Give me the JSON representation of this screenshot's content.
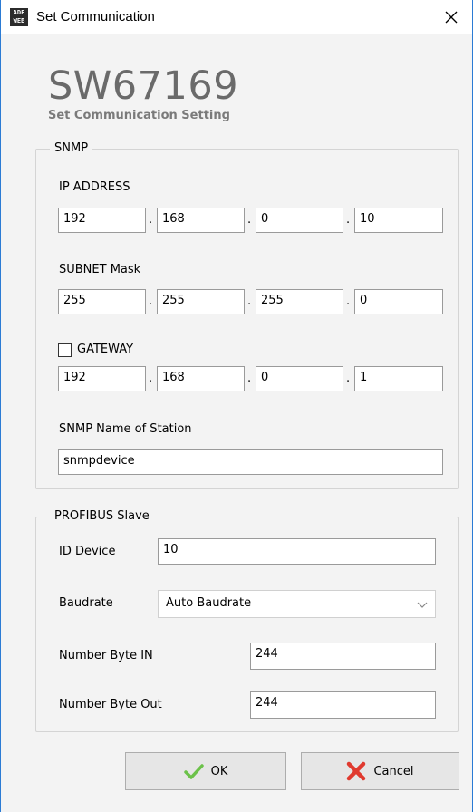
{
  "window": {
    "title": "Set Communication",
    "app_icon_text": "ADF WEB"
  },
  "header": {
    "title": "SW67169",
    "subtitle": "Set Communication Setting"
  },
  "snmp": {
    "legend": "SNMP",
    "ip_label": "IP ADDRESS",
    "ip": [
      "192",
      "168",
      "0",
      "10"
    ],
    "subnet_label": "SUBNET Mask",
    "subnet": [
      "255",
      "255",
      "255",
      "0"
    ],
    "gateway_label": "GATEWAY",
    "gateway_checked": false,
    "gateway": [
      "192",
      "168",
      "0",
      "1"
    ],
    "station_label": "SNMP Name of Station",
    "station_value": "snmpdevice",
    "dot": "."
  },
  "profibus": {
    "legend": "PROFIBUS Slave",
    "id_label": "ID Device",
    "id_value": "10",
    "baud_label": "Baudrate",
    "baud_value": "Auto Baudrate",
    "byte_in_label": "Number Byte IN",
    "byte_in_value": "244",
    "byte_out_label": "Number Byte Out",
    "byte_out_value": "244"
  },
  "buttons": {
    "ok": "OK",
    "cancel": "Cancel"
  },
  "colors": {
    "accent": "#2b7bd4",
    "ok_check": "#6cc24a",
    "cancel_x": "#e03a2f"
  }
}
